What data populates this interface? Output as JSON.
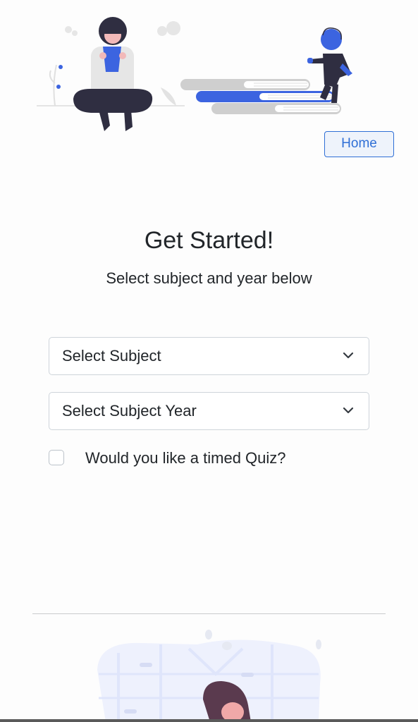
{
  "header": {
    "home_label": "Home",
    "illustration_icon": "reading-person-and-books-illustration"
  },
  "main": {
    "title": "Get Started!",
    "subtitle": "Select subject and year below",
    "subject_select": {
      "value": "Select Subject",
      "icon": "chevron-down-icon"
    },
    "year_select": {
      "value": "Select Subject Year",
      "icon": "chevron-down-icon"
    },
    "timed_quiz": {
      "label": "Would you like a timed Quiz?",
      "checked": false
    }
  },
  "footer": {
    "illustration_icon": "person-at-window-illustration"
  },
  "colors": {
    "accent": "#2f6fd6",
    "illustration_blue": "#3c64e0",
    "illustration_dark": "#2f2e41"
  }
}
